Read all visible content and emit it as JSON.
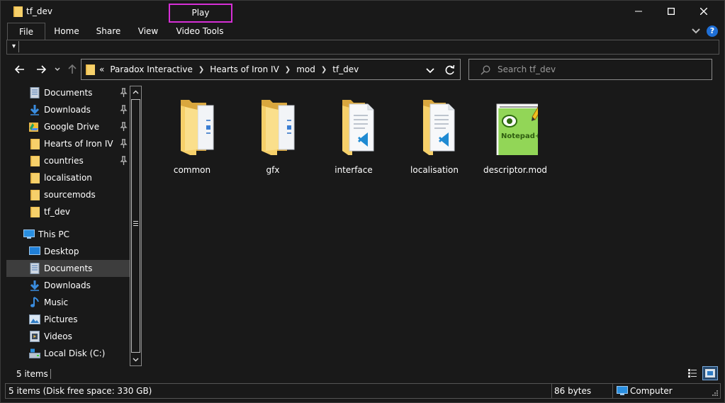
{
  "window": {
    "title": "tf_dev",
    "context_tab": "Play",
    "controls": {
      "minimize": "minimize",
      "maximize": "maximize",
      "close": "close"
    }
  },
  "ribbon": {
    "tabs": [
      "File",
      "Home",
      "Share",
      "View",
      "Video Tools"
    ],
    "help": "?"
  },
  "quick_access": {
    "customize": "▾"
  },
  "address": {
    "overflow": "«",
    "crumbs": [
      "Paradox Interactive",
      "Hearts of Iron IV",
      "mod",
      "tf_dev"
    ]
  },
  "search": {
    "placeholder": "Search tf_dev"
  },
  "nav_pane": {
    "quick_access": [
      {
        "label": "Documents",
        "icon": "documents-icon",
        "pinned": true
      },
      {
        "label": "Downloads",
        "icon": "downloads-icon",
        "pinned": true
      },
      {
        "label": "Google Drive",
        "icon": "google-drive-icon",
        "pinned": true
      },
      {
        "label": "Hearts of Iron IV",
        "icon": "folder-icon",
        "pinned": true
      },
      {
        "label": "countries",
        "icon": "folder-icon",
        "pinned": true
      },
      {
        "label": "localisation",
        "icon": "folder-icon",
        "pinned": false
      },
      {
        "label": "sourcemods",
        "icon": "folder-icon",
        "pinned": false
      },
      {
        "label": "tf_dev",
        "icon": "folder-icon",
        "pinned": false
      }
    ],
    "this_pc": "This PC",
    "pc_items": [
      {
        "label": "Desktop",
        "icon": "desktop-icon",
        "selected": false
      },
      {
        "label": "Documents",
        "icon": "documents-icon",
        "selected": true
      },
      {
        "label": "Downloads",
        "icon": "downloads-icon",
        "selected": false
      },
      {
        "label": "Music",
        "icon": "music-icon",
        "selected": false
      },
      {
        "label": "Pictures",
        "icon": "pictures-icon",
        "selected": false
      },
      {
        "label": "Videos",
        "icon": "videos-icon",
        "selected": false
      },
      {
        "label": "Local Disk (C:)",
        "icon": "disk-icon",
        "selected": false
      }
    ]
  },
  "files": [
    {
      "name": "common",
      "type": "folder"
    },
    {
      "name": "gfx",
      "type": "folder"
    },
    {
      "name": "interface",
      "type": "folder-vscode"
    },
    {
      "name": "localisation",
      "type": "folder-vscode"
    },
    {
      "name": "descriptor.mod",
      "type": "notepad-file"
    }
  ],
  "status": {
    "items_count": "5 items",
    "disk": "5 items (Disk free space: 330 GB)",
    "size": "86 bytes",
    "location": "Computer"
  },
  "colors": {
    "background": "#191919",
    "folder": "#f4c660",
    "accent_tab_border": "#d62fd6",
    "selection": "#3d3d3d"
  }
}
